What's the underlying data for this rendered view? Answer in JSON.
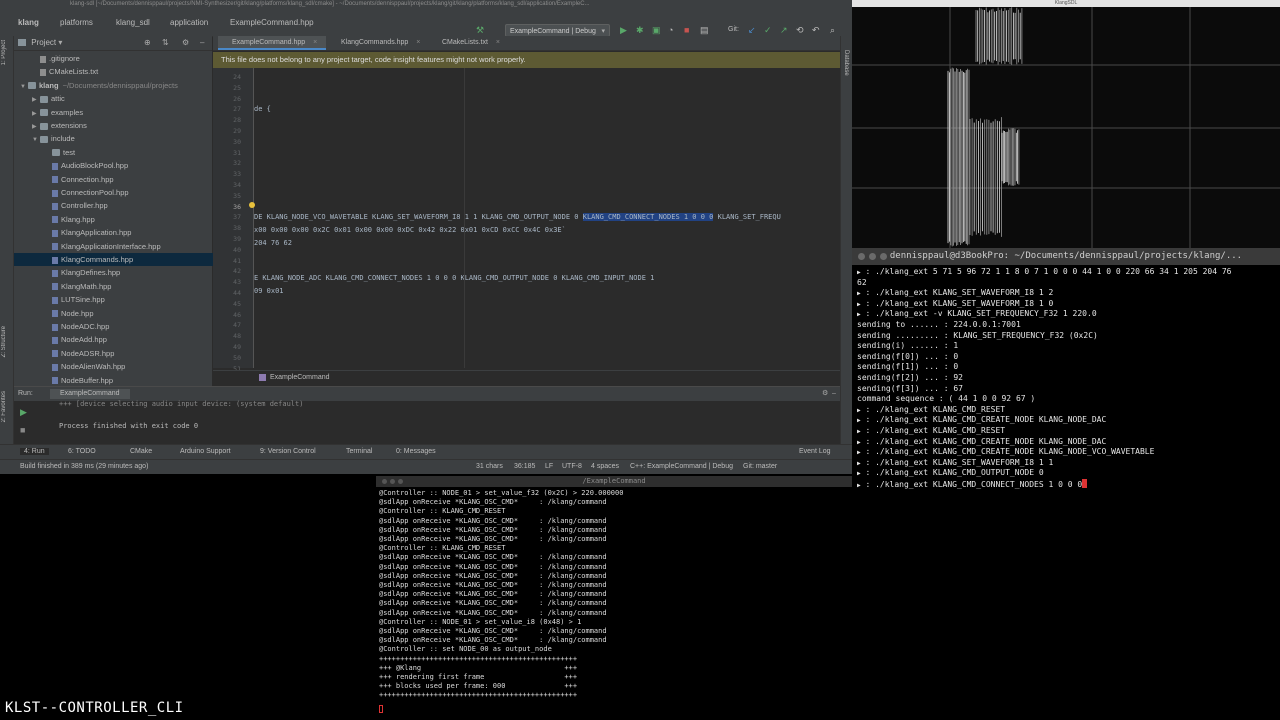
{
  "ide": {
    "title": "klang-sdl [~/Documents/dennisppaul/projects/NMI-Synthesizer/git/klang/platforms/klang_sdl/cmake] - ~/Documents/dennisppaul/projects/klang/git/klang/platforms/klang_sdl/application/ExampleC...",
    "breadcrumbs": [
      "klang",
      "platforms",
      "klang_sdl",
      "application",
      "ExampleCommand.hpp"
    ],
    "run_config": "ExampleCommand | Debug",
    "git_label": "Git:",
    "project_header": "Project",
    "left_tabs": [
      "1: Project",
      "Z: Structure",
      "2: Favorites"
    ],
    "right_tabs": [
      "Database"
    ],
    "tree": [
      {
        "label": ".gitignore",
        "kind": "file",
        "indent": 2
      },
      {
        "label": "CMakeLists.txt",
        "kind": "file",
        "indent": 2
      },
      {
        "label": "klang",
        "suffix": "~/Documents/dennisppaul/projects",
        "kind": "folder",
        "indent": 1,
        "arrow": "▼"
      },
      {
        "label": "attic",
        "kind": "folder",
        "indent": 2,
        "arrow": "▶"
      },
      {
        "label": "examples",
        "kind": "folder",
        "indent": 2,
        "arrow": "▶"
      },
      {
        "label": "extensions",
        "kind": "folder",
        "indent": 2,
        "arrow": "▶"
      },
      {
        "label": "include",
        "kind": "folder",
        "indent": 2,
        "arrow": "▼"
      },
      {
        "label": "test",
        "kind": "folder",
        "indent": 3
      },
      {
        "label": "AudioBlockPool.hpp",
        "kind": "hpp",
        "indent": 3
      },
      {
        "label": "Connection.hpp",
        "kind": "hpp",
        "indent": 3
      },
      {
        "label": "ConnectionPool.hpp",
        "kind": "hpp",
        "indent": 3
      },
      {
        "label": "Controller.hpp",
        "kind": "hpp",
        "indent": 3
      },
      {
        "label": "Klang.hpp",
        "kind": "hpp",
        "indent": 3
      },
      {
        "label": "KlangApplication.hpp",
        "kind": "hpp",
        "indent": 3
      },
      {
        "label": "KlangApplicationInterface.hpp",
        "kind": "hpp",
        "indent": 3
      },
      {
        "label": "KlangCommands.hpp",
        "kind": "hpp",
        "indent": 3,
        "selected": true
      },
      {
        "label": "KlangDefines.hpp",
        "kind": "hpp",
        "indent": 3
      },
      {
        "label": "KlangMath.hpp",
        "kind": "hpp",
        "indent": 3
      },
      {
        "label": "LUTSine.hpp",
        "kind": "hpp",
        "indent": 3
      },
      {
        "label": "Node.hpp",
        "kind": "hpp",
        "indent": 3
      },
      {
        "label": "NodeADC.hpp",
        "kind": "hpp",
        "indent": 3
      },
      {
        "label": "NodeAdd.hpp",
        "kind": "hpp",
        "indent": 3
      },
      {
        "label": "NodeADSR.hpp",
        "kind": "hpp",
        "indent": 3
      },
      {
        "label": "NodeAlienWah.hpp",
        "kind": "hpp",
        "indent": 3
      },
      {
        "label": "NodeBuffer.hpp",
        "kind": "hpp",
        "indent": 3
      }
    ],
    "editor_tabs": [
      "ExampleCommand.hpp",
      "KlangCommands.hpp",
      "CMakeLists.txt"
    ],
    "banner": "This file does not belong to any project target, code insight features might not work properly.",
    "line_numbers": [
      "24",
      "25",
      "26",
      "27",
      "28",
      "29",
      "30",
      "31",
      "32",
      "33",
      "34",
      "35",
      "36",
      "37",
      "38",
      "39",
      "40",
      "41",
      "42",
      "43",
      "44",
      "45",
      "46",
      "47",
      "48",
      "49",
      "50",
      "51",
      "52"
    ],
    "code": {
      "l28": "de {",
      "l36_pre": "DE KLANG_NODE_VCO_WAVETABLE KLANG_SET_WAVEFORM_I8 1 1 KLANG_CMD_OUTPUT_NODE 0 ",
      "l36_hl": "KLANG_CMD_CONNECT_NODES 1 0 0 0",
      "l36_post": " KLANG_SET_FREQU",
      "l37": "x00 0x00 0x00 0x2C 0x01 0x00 0x00 0xDC 0x42 0x22 0x01 0xCD 0xCC 0x4C 0x3E`",
      "l38": "204 76 62",
      "l41": "E KLANG_NODE_ADC KLANG_CMD_CONNECT_NODES 1 0 0 0 KLANG_CMD_OUTPUT_NODE 0 KLANG_CMD_INPUT_NODE 1",
      "l42": "09 0x01"
    },
    "editor_footer": "ExampleCommand",
    "run_label": "Run:",
    "run_tab": "ExampleCommand",
    "run_output_1": "+++ [device selecting audio input device: (system default)",
    "run_output_2": "Process finished with exit code 0",
    "bottom_tabs": [
      "4: Run",
      "6: TODO",
      "CMake",
      "Arduino Support",
      "9: Version Control",
      "Terminal",
      "0: Messages"
    ],
    "event_log": "Event Log",
    "status_left": "Build finished in 389 ms (29 minutes ago)",
    "status_right": [
      "31 chars",
      "36:185",
      "LF",
      "UTF-8",
      "4 spaces",
      "C++: ExampleCommand | Debug",
      "Git: master"
    ]
  },
  "render": {
    "title": "KlangSDL"
  },
  "terminal": {
    "title": "dennisppaul@d3BookPro: ~/Documents/dennisppaul/projects/klang/...",
    "lines": [
      {
        "p": "",
        "t": " : ./klang_ext 5 71 5 96 72 1 1 8 0 7 1 0 0 0 44 1 0 0 220 66 34 1 205 204 76"
      },
      {
        "p": "",
        "t": "62",
        "plain": true
      },
      {
        "p": "",
        "t": " : ./klang_ext KLANG_SET_WAVEFORM_I8 1 2"
      },
      {
        "p": "",
        "t": " : ./klang_ext KLANG_SET_WAVEFORM_I8 1 0"
      },
      {
        "p": "",
        "t": " : ./klang_ext -v KLANG_SET_FREQUENCY_F32 1 220.0"
      },
      {
        "p": "",
        "t": "sending to ...... : 224.0.0.1:7001",
        "plain": true
      },
      {
        "p": "",
        "t": "sending ......... : KLANG_SET_FREQUENCY_F32 (0x2C)",
        "plain": true
      },
      {
        "p": "",
        "t": "sending(i) ...... : 1",
        "plain": true
      },
      {
        "p": "",
        "t": "sending(f[0]) ... : 0",
        "plain": true
      },
      {
        "p": "",
        "t": "sending(f[1]) ... : 0",
        "plain": true
      },
      {
        "p": "",
        "t": "sending(f[2]) ... : 92",
        "plain": true
      },
      {
        "p": "",
        "t": "sending(f[3]) ... : 67",
        "plain": true
      },
      {
        "p": "",
        "t": "command sequence  : ( 44 1 0 0 92 67 )",
        "plain": true
      },
      {
        "p": "",
        "t": " : ./klang_ext KLANG_CMD_RESET"
      },
      {
        "p": "",
        "t": " : ./klang_ext KLANG_CMD_CREATE_NODE KLANG_NODE_DAC"
      },
      {
        "p": "",
        "t": " : ./klang_ext KLANG_CMD_RESET"
      },
      {
        "p": "",
        "t": " : ./klang_ext KLANG_CMD_CREATE_NODE KLANG_NODE_DAC"
      },
      {
        "p": "",
        "t": " : ./klang_ext KLANG_CMD_CREATE_NODE KLANG_NODE_VCO_WAVETABLE"
      },
      {
        "p": "",
        "t": " : ./klang_ext KLANG_SET_WAVEFORM_I8 1 1"
      },
      {
        "p": "",
        "t": " : ./klang_ext KLANG_CMD_OUTPUT_NODE 0"
      },
      {
        "p": "",
        "t": " : ./klang_ext KLANG_CMD_CONNECT_NODES 1 0 0 0",
        "cursor": true
      }
    ]
  },
  "controller": {
    "title": "/ExampleCommand",
    "lines": [
      "@Controller :: NODE_01 > set_value_f32 (0x2C) > 220.000000",
      "@sdlApp onReceive *KLANG_OSC_CMD*     : /klang/command",
      "@Controller :: KLANG_CMD_RESET",
      "@sdlApp onReceive *KLANG_OSC_CMD*     : /klang/command",
      "@sdlApp onReceive *KLANG_OSC_CMD*     : /klang/command",
      "@sdlApp onReceive *KLANG_OSC_CMD*     : /klang/command",
      "@Controller :: KLANG_CMD_RESET",
      "@sdlApp onReceive *KLANG_OSC_CMD*     : /klang/command",
      "@sdlApp onReceive *KLANG_OSC_CMD*     : /klang/command",
      "@sdlApp onReceive *KLANG_OSC_CMD*     : /klang/command",
      "@sdlApp onReceive *KLANG_OSC_CMD*     : /klang/command",
      "@sdlApp onReceive *KLANG_OSC_CMD*     : /klang/command",
      "@sdlApp onReceive *KLANG_OSC_CMD*     : /klang/command",
      "@sdlApp onReceive *KLANG_OSC_CMD*     : /klang/command",
      "@Controller :: NODE_01 > set_value_i8 (0x48) > 1",
      "@sdlApp onReceive *KLANG_OSC_CMD*     : /klang/command",
      "@sdlApp onReceive *KLANG_OSC_CMD*     : /klang/command",
      "@Controller :: set NODE_00 as output_node",
      "+++++++++++++++++++++++++++++++++++++++++++++++",
      "+++ @Klang                                  +++",
      "+++ rendering first frame                   +++",
      "+++ blocks used per frame: 000              +++",
      "+++++++++++++++++++++++++++++++++++++++++++++++"
    ]
  },
  "caption": "KLST--CONTROLLER_CLI",
  "colors": {
    "selection": "#214283",
    "banner": "#5d5a33",
    "prompt": "#7ec97e",
    "cursor": "#d33333"
  }
}
